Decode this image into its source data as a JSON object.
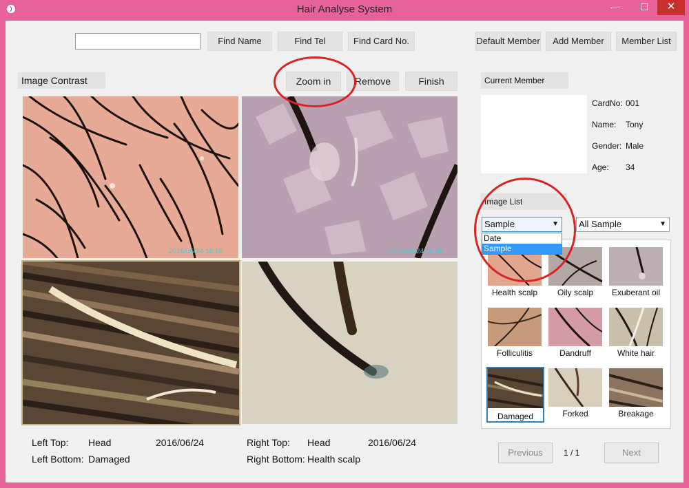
{
  "window": {
    "title": "Hair Analyse System",
    "minimize": "—",
    "maximize": "☐",
    "close": "✕"
  },
  "toolbar": {
    "search_value": "",
    "find_name": "Find Name",
    "find_tel": "Find Tel",
    "find_card": "Find Card No.",
    "default_member": "Default Member",
    "add_member": "Add Member",
    "member_list": "Member List"
  },
  "contrast": {
    "label": "Image Contrast",
    "zoom_in": "Zoom in",
    "remove": "Remove",
    "finish": "Finish",
    "ts_top_left": "2016/06/24 18:10",
    "ts_top_right": "2016/06/24 18:08"
  },
  "captions": {
    "left_top_label": "Left Top:",
    "left_top_area": "Head",
    "left_top_date": "2016/06/24",
    "left_bottom_label": "Left Bottom:",
    "left_bottom_value": "Damaged",
    "right_top_label": "Right Top:",
    "right_top_area": "Head",
    "right_top_date": "2016/06/24",
    "right_bottom_label": "Right Bottom:",
    "right_bottom_value": "Health scalp"
  },
  "member": {
    "label": "Current Member",
    "card_label": "CardNo:",
    "card_value": "001",
    "name_label": "Name:",
    "name_value": "Tony",
    "gender_label": "Gender:",
    "gender_value": "Male",
    "age_label": "Age:",
    "age_value": "34"
  },
  "image_list": {
    "label": "Image List",
    "sort_selected": "Sample",
    "sort_options": [
      "Date",
      "Sample"
    ],
    "filter_selected": "All Sample",
    "thumbnails": [
      "Health scalp",
      "Oily scalp",
      "Exuberant oil",
      "Folliculitis",
      "Dandruff",
      "White hair",
      "Damaged",
      "Forked",
      "Breakage"
    ],
    "previous": "Previous",
    "page": "1 / 1",
    "next": "Next"
  },
  "colors": {
    "frame": "#e8629a",
    "annotation_ring": "#d92323",
    "selection_blue": "#3399ff"
  }
}
